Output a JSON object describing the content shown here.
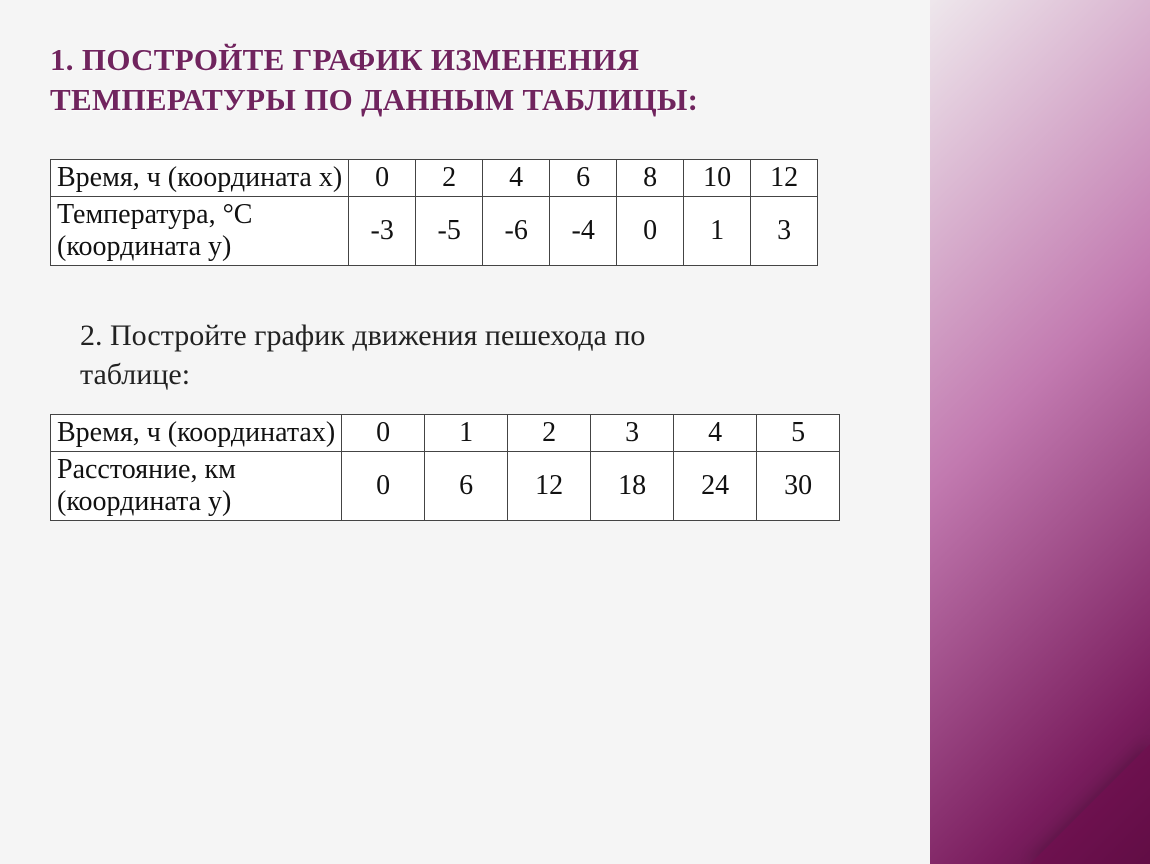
{
  "task1": {
    "title_line1": "1. ПОСТРОЙТЕ ГРАФИК ИЗМЕНЕНИЯ",
    "title_line2": "ТЕМПЕРАТУРЫ ПО ДАННЫМ ТАБЛИЦЫ:",
    "row1_label": "Время, ч (координата х)",
    "row2_label_line1": "Температура, °С",
    "row2_label_line2": "(координата у)"
  },
  "task2": {
    "subtitle_line1": "2. Постройте график движения пешехода по",
    "subtitle_line2": "таблице:",
    "row1_label": " Время, ч (координатах)",
    "row2_label_line1": "Расстояние, км",
    "row2_label_line2": "(координата у)"
  },
  "chart_data": [
    {
      "type": "table",
      "for": "task1",
      "x_label": "Время, ч (координата х)",
      "y_label": "Температура, °С (координата у)",
      "x": [
        "0",
        "2",
        "4",
        "6",
        "8",
        "10",
        "12"
      ],
      "y": [
        "-3",
        "-5",
        "-6",
        "-4",
        "0",
        "1",
        "3"
      ]
    },
    {
      "type": "table",
      "for": "task2",
      "x_label": "Время, ч (координатах)",
      "y_label": "Расстояние, км (координата у)",
      "x": [
        "0",
        "1",
        "2",
        "3",
        "4",
        "5"
      ],
      "y": [
        "0",
        "6",
        "12",
        "18",
        "24",
        "30"
      ]
    }
  ]
}
